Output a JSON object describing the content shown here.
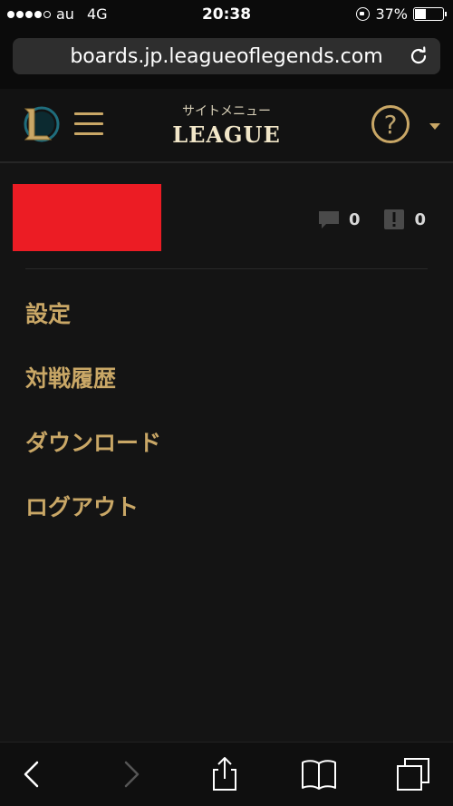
{
  "status_bar": {
    "carrier": "au",
    "network": "4G",
    "time": "20:38",
    "battery": "37%",
    "battery_level": 0.37,
    "signal_bars_filled": 4,
    "signal_bars_total": 5
  },
  "browser": {
    "url": "boards.jp.leagueoflegends.com"
  },
  "header": {
    "site_menu_label": "サイトメニュー",
    "brand": "LEAGUE",
    "help_symbol": "?"
  },
  "user": {
    "comments_count": "0",
    "alerts_count": "0"
  },
  "menu": {
    "items": [
      {
        "label": "設定"
      },
      {
        "label": "対戦履歴"
      },
      {
        "label": "ダウンロード"
      },
      {
        "label": "ログアウト"
      }
    ]
  },
  "colors": {
    "accent_gold": "#c9a766",
    "background": "#141414",
    "redacted": "#ec1c24"
  },
  "icons": {
    "logo": "lol-logo-icon",
    "menu": "hamburger-icon",
    "help": "help-icon",
    "comments": "speech-bubble-icon",
    "alerts": "alert-icon",
    "reload": "reload-icon",
    "back": "chevron-left-icon",
    "forward": "chevron-right-icon",
    "share": "share-icon",
    "bookmarks": "book-icon",
    "tabs": "tabs-icon"
  }
}
